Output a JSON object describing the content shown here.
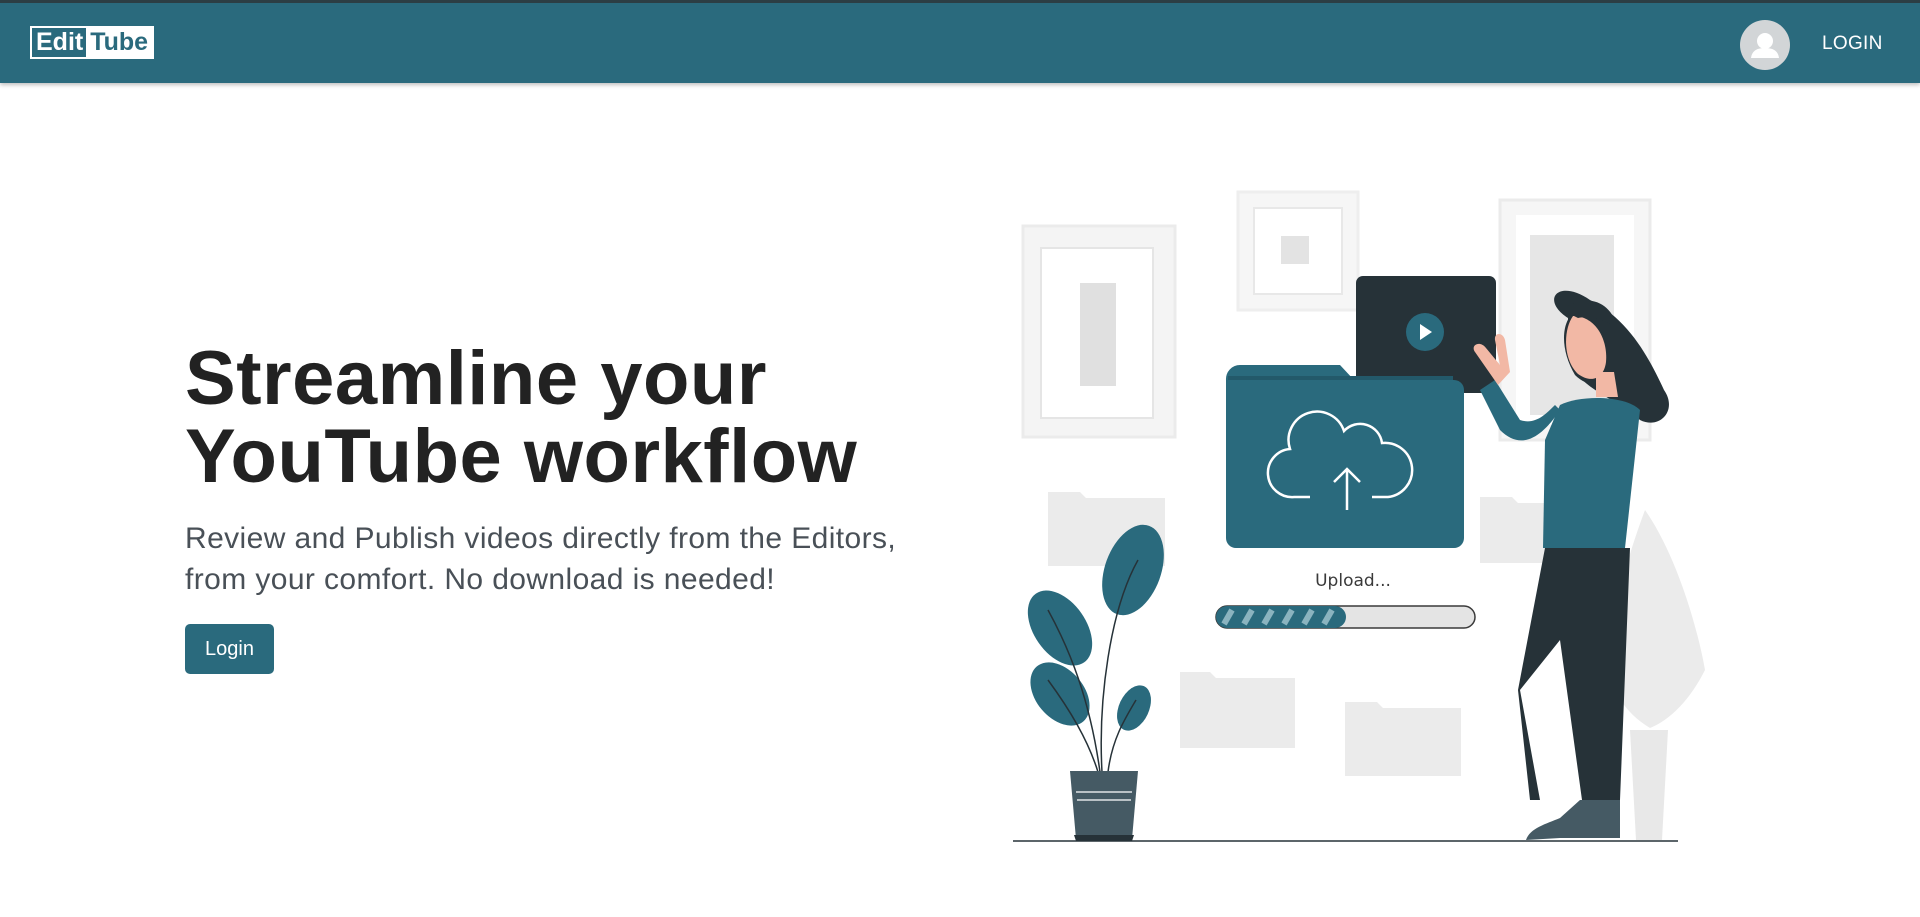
{
  "app": {
    "logo_edit": "Edit",
    "logo_tube": "Tube"
  },
  "header": {
    "avatar_icon": "user-avatar-icon",
    "login_label": "LOGIN"
  },
  "hero": {
    "title_line1": "Streamline your",
    "title_line2": "YouTube workflow",
    "subtitle_line1": "Review and Publish videos directly from the Editors,",
    "subtitle_line2": "from your comfort. No download is needed!",
    "cta_label": "Login"
  },
  "illustration": {
    "upload_text": "Upload...",
    "upload_progress": 0.5
  },
  "colors": {
    "brand": "#2a6a7d",
    "dark": "#263238",
    "text": "#222222",
    "muted": "#495057"
  }
}
